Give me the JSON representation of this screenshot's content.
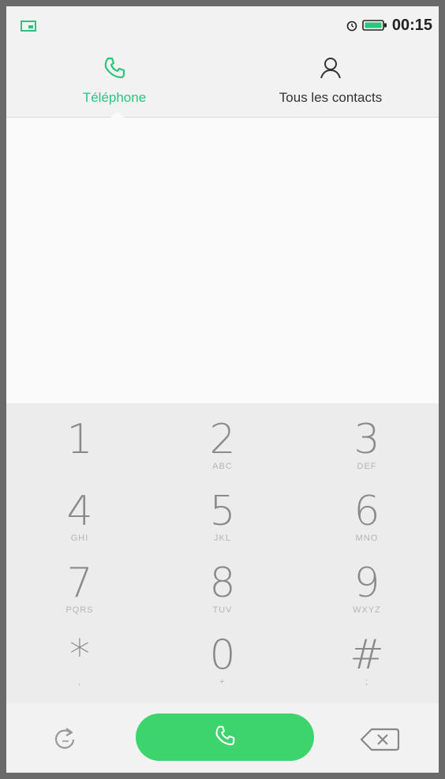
{
  "status_bar": {
    "time": "00:15",
    "left_icon": "screenshot-icon",
    "icons": [
      "alarm-icon",
      "battery-icon"
    ]
  },
  "tabs": [
    {
      "label": "Téléphone",
      "icon": "phone-icon",
      "active": true
    },
    {
      "label": "Tous les contacts",
      "icon": "person-icon",
      "active": false
    }
  ],
  "keypad": {
    "keys": [
      {
        "digit": "1",
        "letters": ""
      },
      {
        "digit": "2",
        "letters": "ABC"
      },
      {
        "digit": "3",
        "letters": "DEF"
      },
      {
        "digit": "4",
        "letters": "GHI"
      },
      {
        "digit": "5",
        "letters": "JKL"
      },
      {
        "digit": "6",
        "letters": "MNO"
      },
      {
        "digit": "7",
        "letters": "PQRS"
      },
      {
        "digit": "8",
        "letters": "TUV"
      },
      {
        "digit": "9",
        "letters": "WXYZ"
      },
      {
        "digit": "*",
        "letters": ","
      },
      {
        "digit": "0",
        "letters": "+"
      },
      {
        "digit": "#",
        "letters": ";"
      }
    ]
  },
  "bottom_bar": {
    "redial_icon": "redial-icon",
    "call_icon": "phone-icon",
    "backspace_icon": "backspace-icon"
  },
  "colors": {
    "accent": "#2bc47f",
    "call_button": "#3dd46d"
  }
}
